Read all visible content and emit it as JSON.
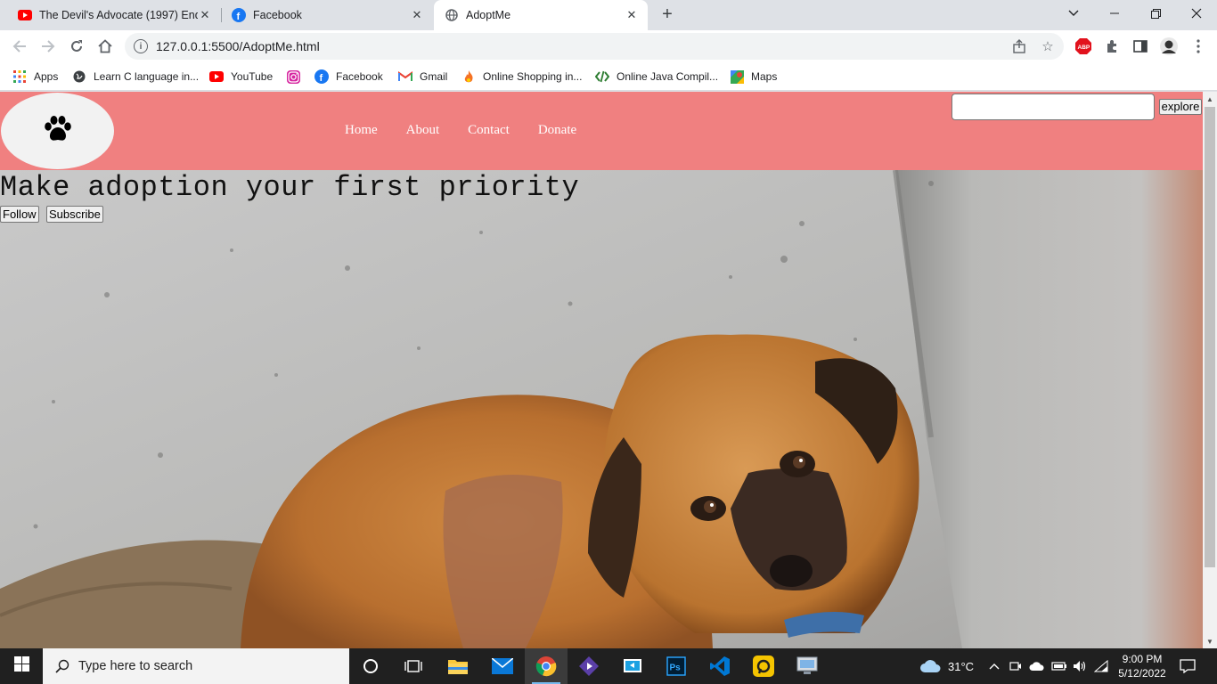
{
  "browser": {
    "tabs": [
      {
        "title": "The Devil's Advocate (1997) Endi",
        "icon": "youtube-icon",
        "active": false
      },
      {
        "title": "Facebook",
        "icon": "facebook-icon",
        "active": false
      },
      {
        "title": "AdoptMe",
        "icon": "globe-icon",
        "active": true
      }
    ],
    "url": "127.0.0.1:5500/AdoptMe.html",
    "bookmarks": [
      {
        "label": "Apps",
        "icon": "apps-grid-icon"
      },
      {
        "label": "Learn C language in...",
        "icon": "globe-icon"
      },
      {
        "label": "YouTube",
        "icon": "youtube-icon"
      },
      {
        "label": "",
        "icon": "instagram-icon"
      },
      {
        "label": "Facebook",
        "icon": "facebook-icon"
      },
      {
        "label": "Gmail",
        "icon": "gmail-icon"
      },
      {
        "label": "Online Shopping in...",
        "icon": "flame-icon"
      },
      {
        "label": "Online Java Compil...",
        "icon": "code-icon"
      },
      {
        "label": "Maps",
        "icon": "maps-icon"
      }
    ]
  },
  "page": {
    "nav": [
      "Home",
      "About",
      "Contact",
      "Donate"
    ],
    "search_value": "",
    "explore_label": "explore",
    "headline": "Make adoption your first priority",
    "follow_label": "Follow",
    "subscribe_label": "Subscribe"
  },
  "taskbar": {
    "search_placeholder": "Type here to search",
    "temperature": "31°C",
    "time": "9:00 PM",
    "date": "5/12/2022"
  },
  "colors": {
    "navbar": "#f08080",
    "logo_bg": "#f2f2f2",
    "taskbar": "#202020"
  }
}
